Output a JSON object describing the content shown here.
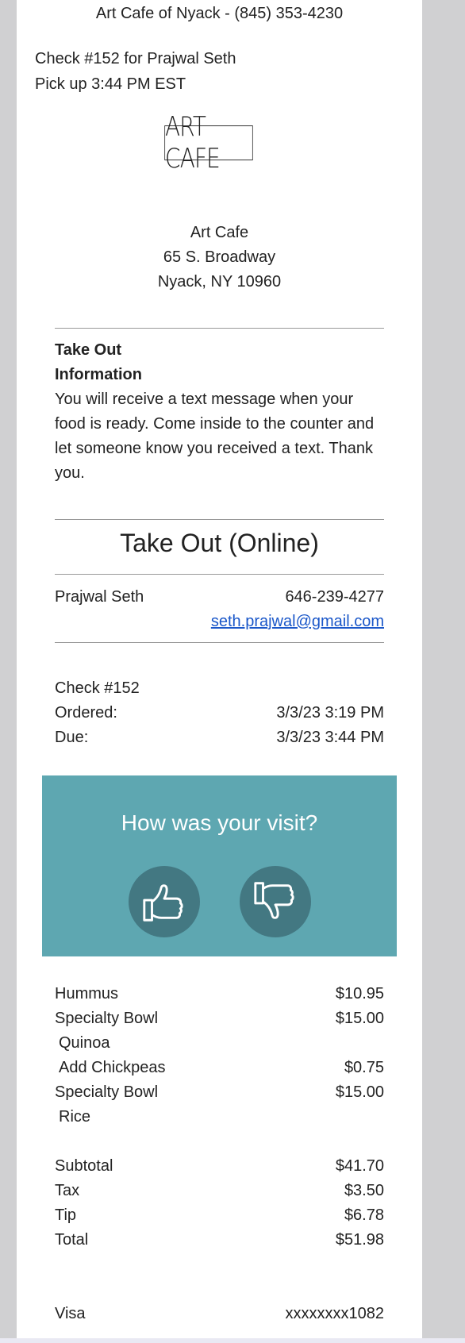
{
  "header": {
    "line": "Art Cafe of Nyack - (845) 353-4230",
    "check_line": "Check #152 for Prajwal Seth",
    "pickup_line": "Pick up 3:44 PM EST"
  },
  "logo_text": "ART CAFE",
  "address": {
    "name": "Art Cafe",
    "street": "65 S. Broadway",
    "city": "Nyack, NY 10960"
  },
  "takeout_info": {
    "title_line1": "Take Out",
    "title_line2": "Information",
    "body": "You will receive a text message when your food is ready. Come inside to the counter and let someone know you received a text. Thank you."
  },
  "order_type": "Take Out (Online)",
  "customer": {
    "name": "Prajwal Seth",
    "phone": "646-239-4277",
    "email": "seth.prajwal@gmail.com"
  },
  "check": {
    "number_label": "Check #152",
    "ordered_label": "Ordered:",
    "ordered_value": "3/3/23 3:19 PM",
    "due_label": "Due:",
    "due_value": "3/3/23 3:44 PM"
  },
  "feedback": {
    "title": "How was your visit?",
    "bg_color": "#5ea7b1",
    "button_color": "#437882",
    "icons": [
      "thumbs-up-icon",
      "thumbs-down-icon"
    ]
  },
  "items": [
    {
      "name": "Hummus",
      "price": "$10.95"
    },
    {
      "name": "Specialty Bowl",
      "price": "$15.00"
    },
    {
      "name": " Quinoa",
      "price": ""
    },
    {
      "name": " Add Chickpeas",
      "price": "$0.75"
    },
    {
      "name": "Specialty Bowl",
      "price": "$15.00"
    },
    {
      "name": " Rice",
      "price": ""
    }
  ],
  "totals": {
    "subtotal_label": "Subtotal",
    "subtotal": "$41.70",
    "tax_label": "Tax",
    "tax": "$3.50",
    "tip_label": "Tip",
    "tip": "$6.78",
    "total_label": "Total",
    "total": "$51.98"
  },
  "payment": {
    "method": "Visa",
    "card": "xxxxxxxx1082"
  }
}
